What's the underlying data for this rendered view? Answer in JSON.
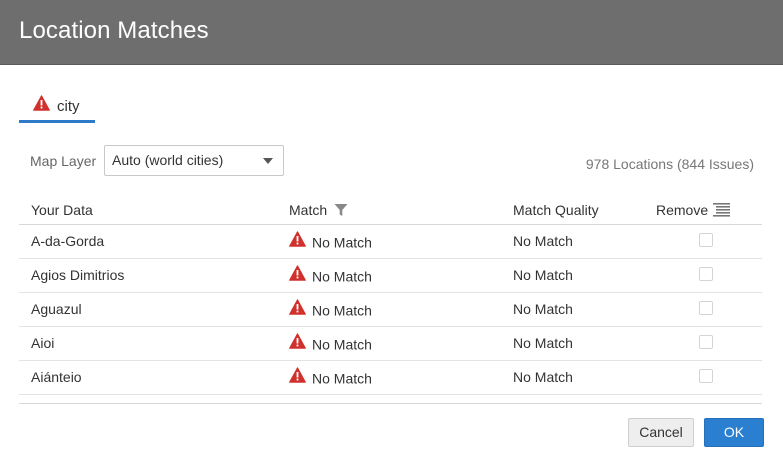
{
  "dialog": {
    "title": "Location Matches"
  },
  "tabs": [
    {
      "label": "city",
      "icon": "warning-icon"
    }
  ],
  "map_layer": {
    "label": "Map Layer",
    "selected": "Auto (world cities)"
  },
  "summary": "978 Locations (844 Issues)",
  "table": {
    "columns": [
      "Your Data",
      "Match",
      "Match Quality",
      "Remove"
    ],
    "rows": [
      {
        "data": "A-da-Gorda",
        "match": "No Match",
        "quality": "No Match",
        "remove": false
      },
      {
        "data": "Agios Dimitrios",
        "match": "No Match",
        "quality": "No Match",
        "remove": false
      },
      {
        "data": "Aguazul",
        "match": "No Match",
        "quality": "No Match",
        "remove": false
      },
      {
        "data": "Aioi",
        "match": "No Match",
        "quality": "No Match",
        "remove": false
      },
      {
        "data": "Aiánteio",
        "match": "No Match",
        "quality": "No Match",
        "remove": false
      }
    ]
  },
  "buttons": {
    "cancel": "Cancel",
    "ok": "OK"
  },
  "colors": {
    "titlebar": "#6e6e6e",
    "accent": "#2b7fd0",
    "warning": "#d0312d"
  }
}
